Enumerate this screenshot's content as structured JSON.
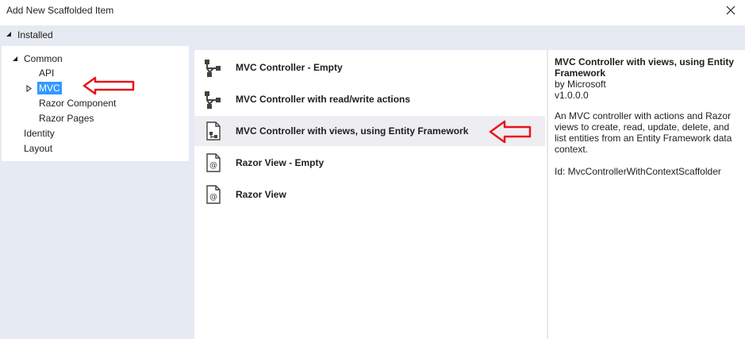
{
  "window": {
    "title": "Add New Scaffolded Item"
  },
  "installed": {
    "label": "Installed"
  },
  "tree": {
    "common": "Common",
    "api": "API",
    "mvc": "MVC",
    "razor_component": "Razor Component",
    "razor_pages": "Razor Pages",
    "identity": "Identity",
    "layout": "Layout"
  },
  "items": [
    {
      "label": "MVC Controller - Empty",
      "icon": "controller-icon"
    },
    {
      "label": "MVC Controller with read/write actions",
      "icon": "controller-icon"
    },
    {
      "label": "MVC Controller with views, using Entity Framework",
      "icon": "controller-views-icon"
    },
    {
      "label": "Razor View - Empty",
      "icon": "razor-view-icon"
    },
    {
      "label": "Razor View",
      "icon": "razor-view-icon"
    }
  ],
  "details": {
    "title": "MVC Controller with views, using Entity Framework",
    "author": "by Microsoft",
    "version": "v1.0.0.0",
    "description": "An MVC controller with actions and Razor views to create, read, update, delete, and list entities from an Entity Framework data context.",
    "id": "Id: MvcControllerWithContextScaffolder"
  },
  "colors": {
    "selection": "#3399ff",
    "panel_background": "#e6eaf2",
    "highlight_row": "#eeeef2",
    "annotation_arrow": "#e8141b"
  }
}
